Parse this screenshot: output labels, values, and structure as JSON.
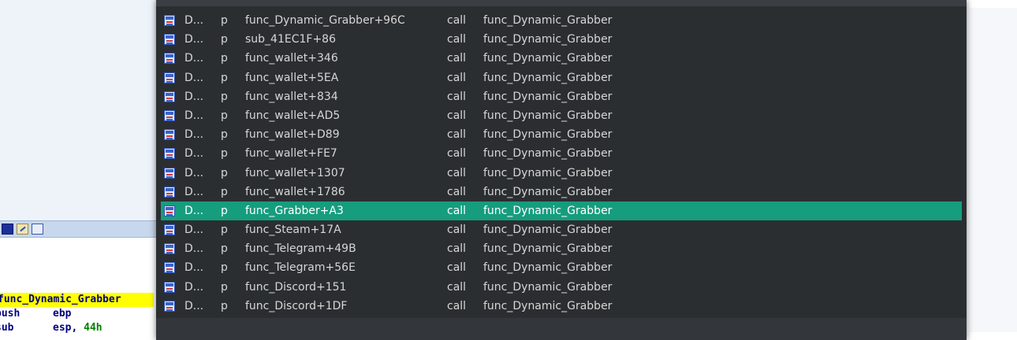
{
  "code": {
    "func_name": "func_Dynamic_Grabber",
    "lines": [
      {
        "mnemonic": "push",
        "operand": "ebp",
        "number": ""
      },
      {
        "mnemonic": "sub",
        "operand": "esp, ",
        "number": "44h"
      }
    ]
  },
  "xrefs": {
    "rows": [
      {
        "dir": "D...",
        "type": "p",
        "address": "func_Dynamic_Grabber+96C",
        "kind": "call",
        "target": "func_Dynamic_Grabber"
      },
      {
        "dir": "D...",
        "type": "p",
        "address": "sub_41EC1F+86",
        "kind": "call",
        "target": "func_Dynamic_Grabber"
      },
      {
        "dir": "D...",
        "type": "p",
        "address": "func_wallet+346",
        "kind": "call",
        "target": "func_Dynamic_Grabber"
      },
      {
        "dir": "D...",
        "type": "p",
        "address": "func_wallet+5EA",
        "kind": "call",
        "target": "func_Dynamic_Grabber"
      },
      {
        "dir": "D...",
        "type": "p",
        "address": "func_wallet+834",
        "kind": "call",
        "target": "func_Dynamic_Grabber"
      },
      {
        "dir": "D...",
        "type": "p",
        "address": "func_wallet+AD5",
        "kind": "call",
        "target": "func_Dynamic_Grabber"
      },
      {
        "dir": "D...",
        "type": "p",
        "address": "func_wallet+D89",
        "kind": "call",
        "target": "func_Dynamic_Grabber"
      },
      {
        "dir": "D...",
        "type": "p",
        "address": "func_wallet+FE7",
        "kind": "call",
        "target": "func_Dynamic_Grabber"
      },
      {
        "dir": "D...",
        "type": "p",
        "address": "func_wallet+1307",
        "kind": "call",
        "target": "func_Dynamic_Grabber"
      },
      {
        "dir": "D...",
        "type": "p",
        "address": "func_wallet+1786",
        "kind": "call",
        "target": "func_Dynamic_Grabber"
      },
      {
        "dir": "D...",
        "type": "p",
        "address": "func_Grabber+A3",
        "kind": "call",
        "target": "func_Dynamic_Grabber"
      },
      {
        "dir": "D...",
        "type": "p",
        "address": "func_Steam+17A",
        "kind": "call",
        "target": "func_Dynamic_Grabber"
      },
      {
        "dir": "D...",
        "type": "p",
        "address": "func_Telegram+49B",
        "kind": "call",
        "target": "func_Dynamic_Grabber"
      },
      {
        "dir": "D...",
        "type": "p",
        "address": "func_Telegram+56E",
        "kind": "call",
        "target": "func_Dynamic_Grabber"
      },
      {
        "dir": "D...",
        "type": "p",
        "address": "func_Discord+151",
        "kind": "call",
        "target": "func_Dynamic_Grabber"
      },
      {
        "dir": "D...",
        "type": "p",
        "address": "func_Discord+1DF",
        "kind": "call",
        "target": "func_Dynamic_Grabber"
      }
    ],
    "selected_index": 10
  },
  "icons": {
    "row_icon": "xref-icon",
    "toolbar": [
      "graph-view-icon",
      "edit-icon",
      "xref-icon"
    ]
  },
  "colors": {
    "dialog_bg": "#2b2e31",
    "selection": "#169d7e",
    "func_highlight": "#ffff00"
  }
}
